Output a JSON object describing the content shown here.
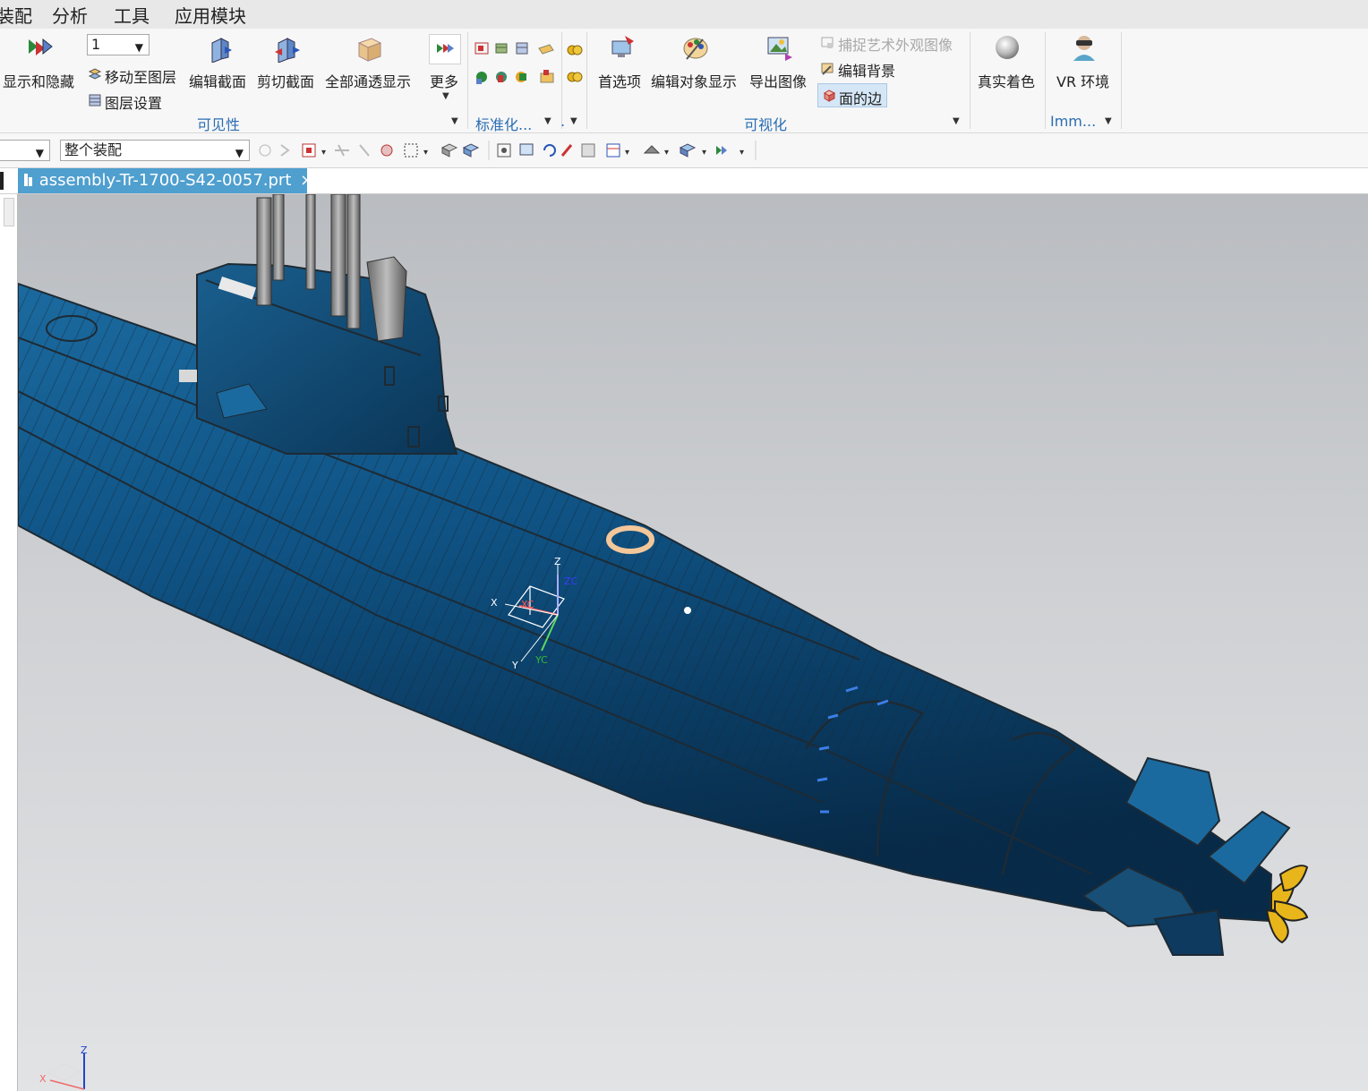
{
  "menubar": {
    "items": [
      "装配",
      "分析",
      "工具",
      "应用模块"
    ]
  },
  "ribbon": {
    "show_hide_label": "显示和隐藏",
    "layer_value": "1",
    "move_to_layer_label": "移动至图层",
    "layer_settings_label": "图层设置",
    "edit_section_label": "编辑截面",
    "clip_section_label": "剪切截面",
    "all_transparent_label": "全部通透显示",
    "more_label": "更多",
    "visibility_group": "可见性",
    "standard_group": "标准化...",
    "dot_group": ".",
    "preferences_label": "首选项",
    "edit_object_display_label": "编辑对象显示",
    "export_image_label": "导出图像",
    "capture_art_label": "捕捉艺术外观图像",
    "edit_background_label": "编辑背景",
    "face_edges_label": "面的边",
    "visualization_group": "可视化",
    "true_shading_label": "真实着色",
    "vr_label": "VR 环境",
    "immersive_group": "Imm..."
  },
  "toolbar": {
    "scope_value": "整个装配"
  },
  "tabs": {
    "file_name": "assembly-Tr-1700-S42-0057.prt",
    "close": "×"
  },
  "axes": {
    "x": "X",
    "y": "Y",
    "z": "Z",
    "xc": "XC",
    "yc": "YC",
    "zc": "ZC"
  },
  "colors": {
    "hull": "#0d4a78",
    "hull_dark": "#0a2f4f",
    "accent": "#2a6db3",
    "tab": "#4f9fcf",
    "propeller": "#e8b51a"
  }
}
